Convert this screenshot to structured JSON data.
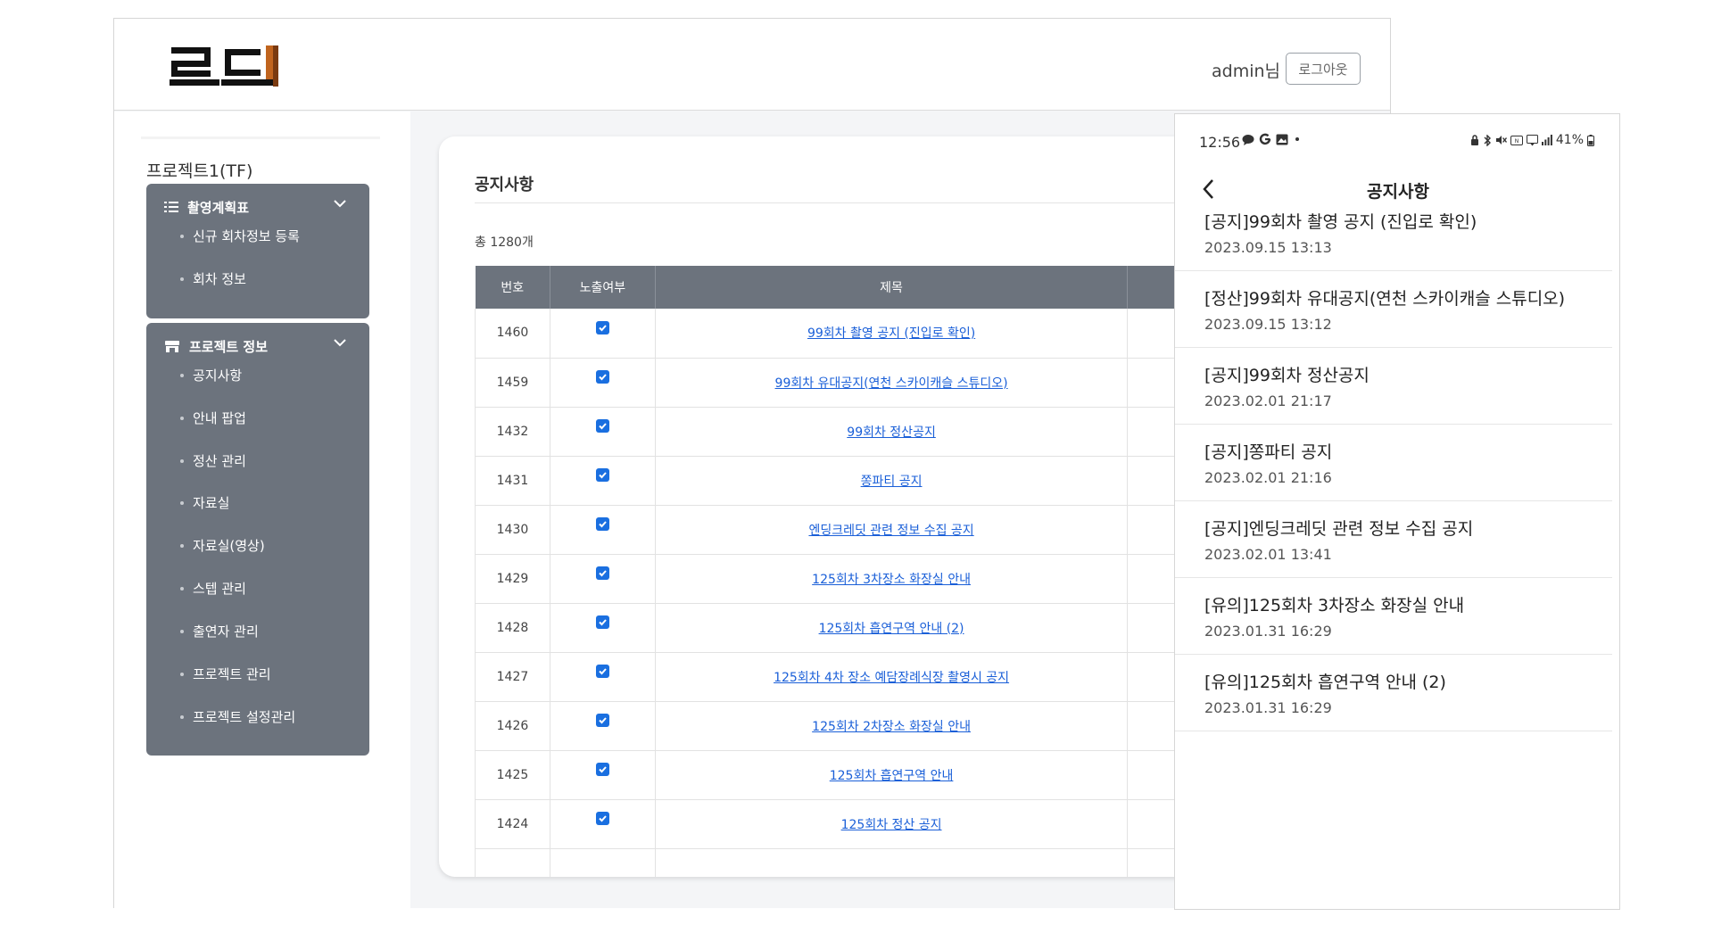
{
  "header": {
    "logo_text": "로드",
    "user_name": "admin님",
    "logout_label": "로그아웃"
  },
  "sidebar": {
    "project_title": "프로젝트1(TF)",
    "groups": [
      {
        "label": "촬영계획표",
        "items": [
          "신규 회차정보 등록",
          "회차 정보"
        ]
      },
      {
        "label": "프로젝트 정보",
        "items": [
          "공지사항",
          "안내 팝업",
          "정산 관리",
          "자료실",
          "자료실(영상)",
          "스텝 관리",
          "출연자 관리",
          "프로젝트 관리",
          "프로젝트 설정관리"
        ]
      }
    ]
  },
  "main": {
    "title": "공지사항",
    "total": "총 1280개",
    "columns": [
      "번호",
      "노출여부",
      "제목"
    ],
    "rows": [
      {
        "num": "1460",
        "title": "99회차 촬영 공지 (진입로 확인)"
      },
      {
        "num": "1459",
        "title": "99회차 유대공지(연천 스카이캐슬 스튜디오)"
      },
      {
        "num": "1432",
        "title": "99회차 정산공지"
      },
      {
        "num": "1431",
        "title": "쫑파티 공지"
      },
      {
        "num": "1430",
        "title": "엔딩크레딧 관련 정보 수집 공지"
      },
      {
        "num": "1429",
        "title": "125회차 3차장소 화장실 안내"
      },
      {
        "num": "1428",
        "title": "125회차 흡연구역 안내 (2)"
      },
      {
        "num": "1427",
        "title": "125회차 4차 장소 예담장례식장 촬영시 공지"
      },
      {
        "num": "1426",
        "title": "125회차 2차장소 화장실 안내"
      },
      {
        "num": "1425",
        "title": "125회차 흡연구역 안내"
      },
      {
        "num": "1424",
        "title": "125회차 정산 공지"
      }
    ]
  },
  "mobile": {
    "time": "12:56",
    "battery": "41%",
    "title": "공지사항",
    "items": [
      {
        "title": "[공지]99회차 촬영 공지 (진입로 확인)",
        "date": "2023.09.15 13:13"
      },
      {
        "title": "[정산]99회차 유대공지(연천 스카이캐슬 스튜디오)",
        "date": "2023.09.15 13:12"
      },
      {
        "title": "[공지]99회차 정산공지",
        "date": "2023.02.01 21:17"
      },
      {
        "title": "[공지]쫑파티 공지",
        "date": "2023.02.01 21:16"
      },
      {
        "title": "[공지]엔딩크레딧 관련 정보 수집 공지",
        "date": "2023.02.01 13:41"
      },
      {
        "title": "[유의]125회차 3차장소 화장실 안내",
        "date": "2023.01.31 16:29"
      },
      {
        "title": "[유의]125회차 흡연구역 안내 (2)",
        "date": "2023.01.31 16:29"
      }
    ]
  },
  "colors": {
    "sidebar_bg": "#6c737d",
    "link": "#1a5fd8",
    "checkbox": "#1a6fe0",
    "logo_accent": "#c0641e"
  }
}
